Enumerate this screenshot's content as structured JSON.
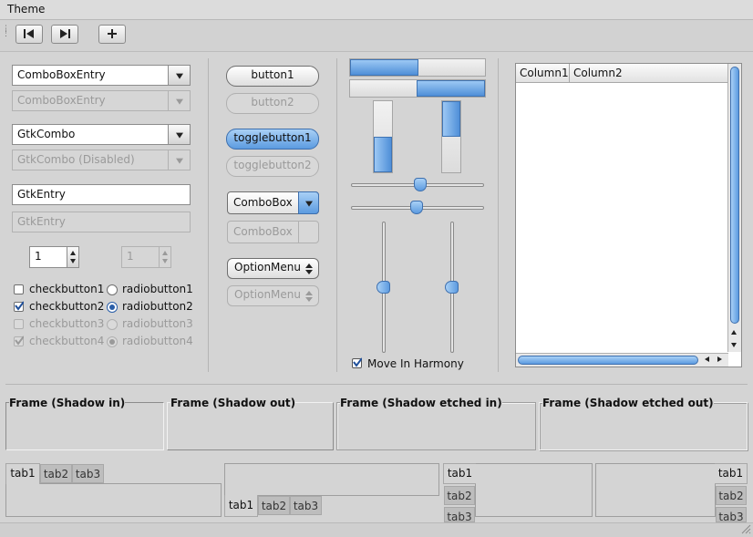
{
  "menubar": {
    "title": "Theme"
  },
  "toolbar": {
    "buttons": [
      "go-first-icon",
      "go-last-icon",
      "add-icon"
    ]
  },
  "left": {
    "combo_entry": {
      "value": "ComboBoxEntry",
      "disabled_value": "ComboBoxEntry"
    },
    "gtk_combo": {
      "value": "GtkCombo",
      "disabled_value": "GtkCombo (Disabled)"
    },
    "entry": {
      "value": "GtkEntry",
      "disabled_value": "GtkEntry"
    },
    "spin": {
      "value": "1",
      "disabled_value": "1"
    },
    "checks": [
      {
        "check": "checkbutton1",
        "radio": "radiobutton1"
      },
      {
        "check": "checkbutton2",
        "radio": "radiobutton2"
      },
      {
        "check": "checkbutton3",
        "radio": "radiobutton3"
      },
      {
        "check": "checkbutton4",
        "radio": "radiobutton4"
      }
    ]
  },
  "middle": {
    "button1": "button1",
    "button2": "button2",
    "toggle1": "togglebutton1",
    "toggle2": "togglebutton2",
    "combobox": "ComboBox",
    "combobox_disabled": "ComboBox",
    "optionmenu": "OptionMenu",
    "optionmenu_disabled": "OptionMenu"
  },
  "sliders": {
    "harmony_label": "Move In Harmony",
    "progress_h": 0.5,
    "progress_v": 0.5
  },
  "tree": {
    "columns": [
      "Column1",
      "Column2"
    ]
  },
  "frames": [
    "Frame (Shadow in)",
    "Frame (Shadow out)",
    "Frame (Shadow etched in)",
    "Frame (Shadow etched out)"
  ],
  "notebooks": {
    "tabs": [
      "tab1",
      "tab2",
      "tab3"
    ]
  },
  "colors": {
    "accent": "#5c9be0",
    "background": "#d4d4d4"
  }
}
